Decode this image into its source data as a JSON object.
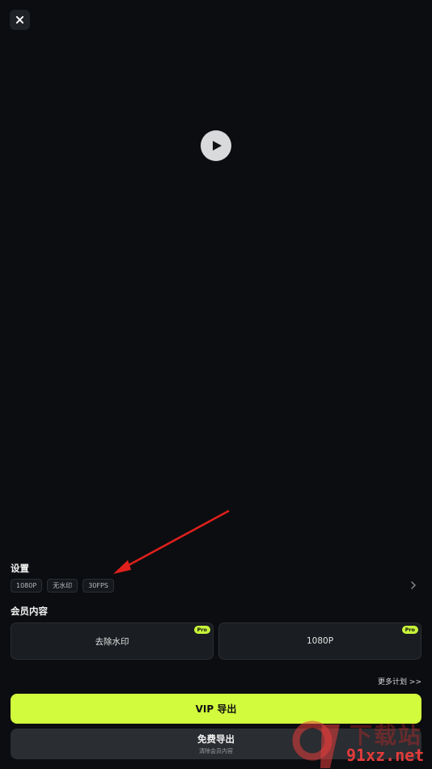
{
  "settings": {
    "title": "设置",
    "chips": [
      "1080P",
      "无水印",
      "30FPS"
    ]
  },
  "member": {
    "title": "会员内容",
    "cards": [
      {
        "label": "去除水印",
        "badge": "Pro"
      },
      {
        "label": "1080P",
        "badge": "Pro"
      }
    ]
  },
  "more_plans": "更多计划 >>",
  "vip_export": "VIP 导出",
  "free_export": {
    "label": "免费导出",
    "sub": "清除会员内容"
  },
  "watermark": {
    "cn": "下载站",
    "en": "91xz.net"
  },
  "colors": {
    "accent": "#d2fb3d",
    "background": "#0b0d10",
    "arrow": "#e0201c"
  }
}
